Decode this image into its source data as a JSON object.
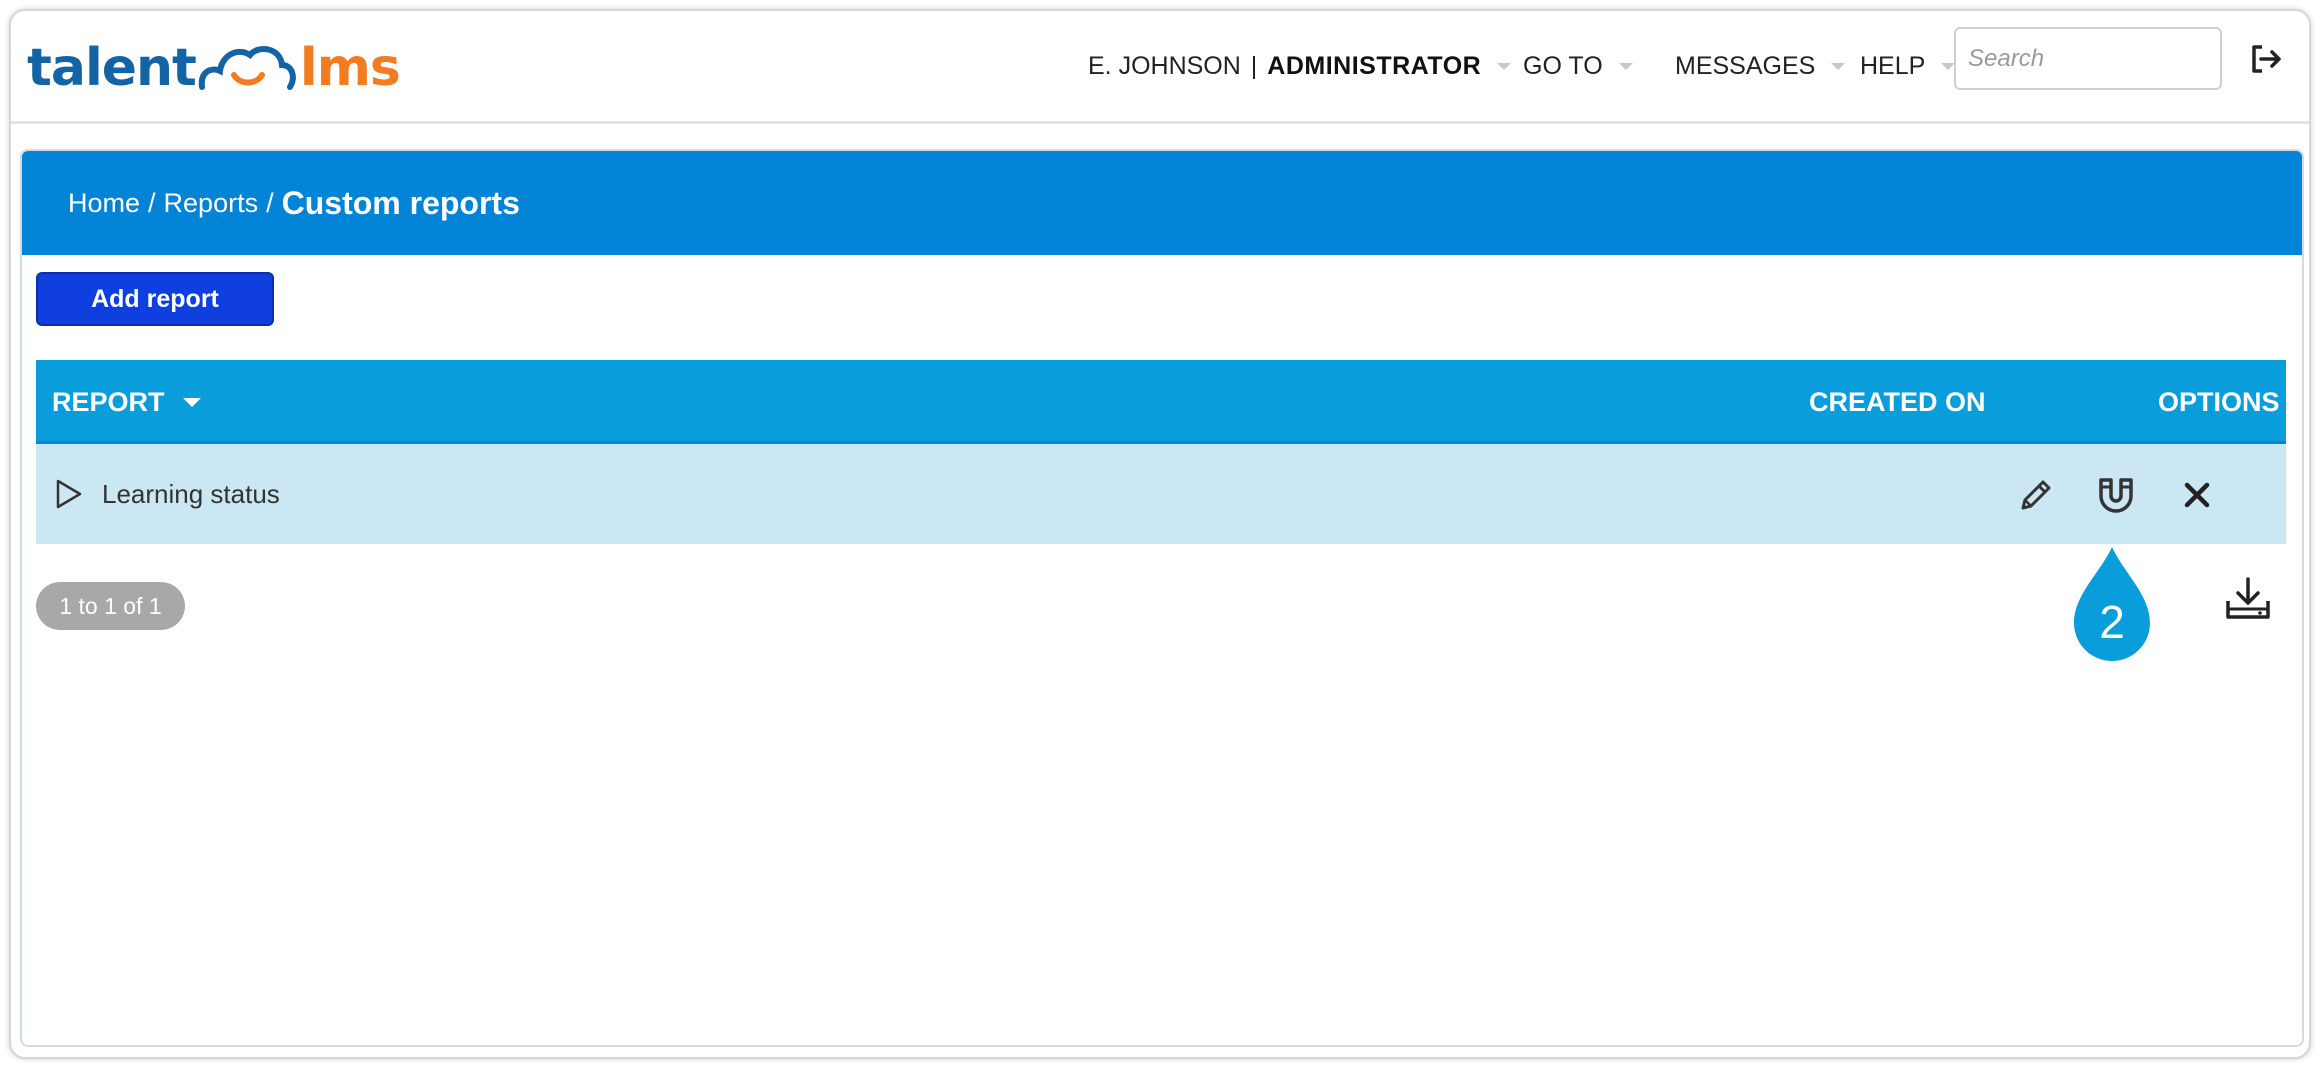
{
  "logo": {
    "part1": "talent",
    "part2": "lms",
    "cloud_color": "#1464a5",
    "accent": "#f47b20"
  },
  "topnav": {
    "user_name": "E. JOHNSON",
    "user_separator": "|",
    "user_role": "ADMINISTRATOR",
    "goto_label": "GO TO",
    "messages_label": "MESSAGES",
    "help_label": "HELP",
    "search_placeholder": "Search",
    "logout_icon": "logout-icon"
  },
  "breadcrumb": {
    "home": "Home",
    "separator": "/",
    "reports": "Reports",
    "current": "Custom reports"
  },
  "toolbar": {
    "add_report_label": "Add report"
  },
  "table": {
    "columns": {
      "report": "REPORT",
      "created_on": "CREATED ON",
      "options": "OPTIONS"
    },
    "rows": [
      {
        "name": "Learning status",
        "created_on": "",
        "options": [
          "edit-icon",
          "magnet-icon",
          "delete-icon"
        ]
      }
    ]
  },
  "pager": {
    "label": "1 to 1 of 1"
  },
  "annotation": {
    "step_number": "2",
    "color": "#0a9ddb"
  },
  "colors": {
    "header_blue": "#0284d6",
    "table_header": "#0a9ddb",
    "row_highlight": "#cce7f4",
    "button_blue": "#0f3fdf"
  }
}
